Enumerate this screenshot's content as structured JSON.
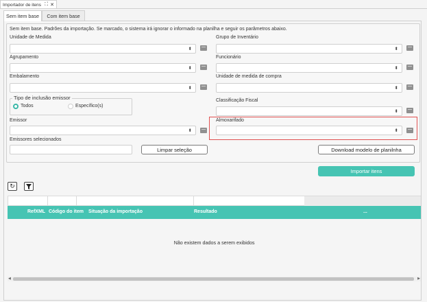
{
  "window_tab": {
    "title": "Importador de itens"
  },
  "tabs": [
    {
      "label": "Sem item base"
    },
    {
      "label": "Com item base"
    }
  ],
  "form": {
    "description": "Sem item base. Padrões da importação. Se marcado, o sistema irá ignorar o informado na planilha e seguir os parâmetros abaixo.",
    "fields": {
      "unidade_medida": "Unidade de Medida",
      "grupo_inventario": "Grupo de Inventário",
      "agrupamento": "Agrupamento",
      "funcionario": "Funcionário",
      "embalamento": "Embalamento",
      "unidade_medida_compra": "Unidade de medida de compra",
      "classificacao_fiscal": "Classificação Fiscal",
      "emissor": "Emissor",
      "almoxarifado": "Almoxarifado",
      "emissores_selecionados": "Emissores selecionados"
    },
    "tipo_inclusao": {
      "legend": "Tipo de inclusão emissor",
      "options": [
        "Todos",
        "Específico(s)"
      ],
      "selected": "Todos"
    },
    "limpar_label": "Limpar seleção",
    "download_label": "Download modelo de planilnha",
    "importar_label": "Importar itens"
  },
  "grid": {
    "columns": [
      "RefXML",
      "Código do item",
      "Situação da importação",
      "Resultado",
      "..."
    ],
    "empty_message": "Não existem dados a serem exibidos"
  },
  "colors": {
    "accent": "#46c4b3",
    "highlight": "#e05050"
  }
}
